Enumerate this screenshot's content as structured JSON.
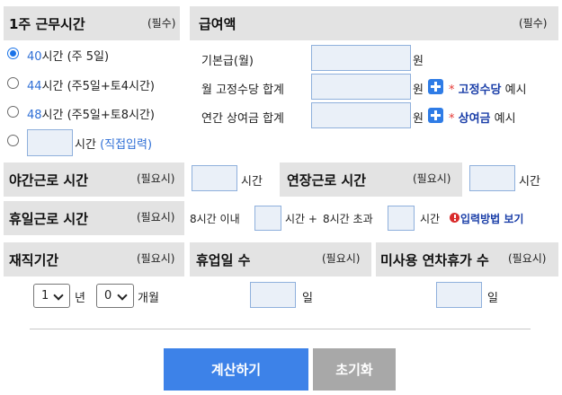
{
  "work_hours": {
    "title": "1주 근무시간",
    "required": "(필수)",
    "options": [
      {
        "value": "40",
        "unit": "시간",
        "note": "(주 5일)",
        "checked": true
      },
      {
        "value": "44",
        "unit": "시간",
        "note": "(주5일+토4시간)",
        "checked": false
      },
      {
        "value": "48",
        "unit": "시간",
        "note": "(주5일+토8시간)",
        "checked": false
      }
    ],
    "custom": {
      "unit": "시간",
      "note": "(직접입력)",
      "value": ""
    }
  },
  "wage": {
    "title": "급여액",
    "required": "(필수)",
    "rows": [
      {
        "label": "기본급(월)",
        "unit": "원",
        "value": ""
      },
      {
        "label": "월 고정수당 합계",
        "unit": "원",
        "value": "",
        "star": "*",
        "link": "고정수당",
        "suffix": "예시"
      },
      {
        "label": "연간 상여금 합계",
        "unit": "원",
        "value": "",
        "star": "*",
        "link": "상여금",
        "suffix": "예시"
      }
    ]
  },
  "night_work": {
    "title": "야간근로 시간",
    "optional": "(필요시)",
    "unit": "시간",
    "value": ""
  },
  "overtime": {
    "title": "연장근로 시간",
    "optional": "(필요시)",
    "unit": "시간",
    "value": ""
  },
  "holiday_work": {
    "title": "휴일근로 시간",
    "optional": "(필요시)",
    "within_label": "8시간 이내",
    "within_unit": "시간 +",
    "over_label": "8시간 초과",
    "over_unit": "시간",
    "guide_link": "입력방법 보기"
  },
  "tenure": {
    "title": "재직기간",
    "optional": "(필요시)",
    "years_value": "1",
    "years_unit": "년",
    "months_value": "0",
    "months_unit": "개월"
  },
  "leave_days": {
    "title": "휴업일 수",
    "optional": "(필요시)",
    "unit": "일",
    "value": ""
  },
  "unused_leave": {
    "title": "미사용 연차휴가 수",
    "optional": "(필요시)",
    "unit": "일",
    "value": ""
  },
  "buttons": {
    "calculate": "계산하기",
    "reset": "초기화"
  },
  "colors": {
    "header_bg": "#e3e3e3",
    "input_bg": "#eaf0f8",
    "primary": "#3d82e8",
    "secondary": "#a8a8a8",
    "link": "#2f6fd6"
  }
}
